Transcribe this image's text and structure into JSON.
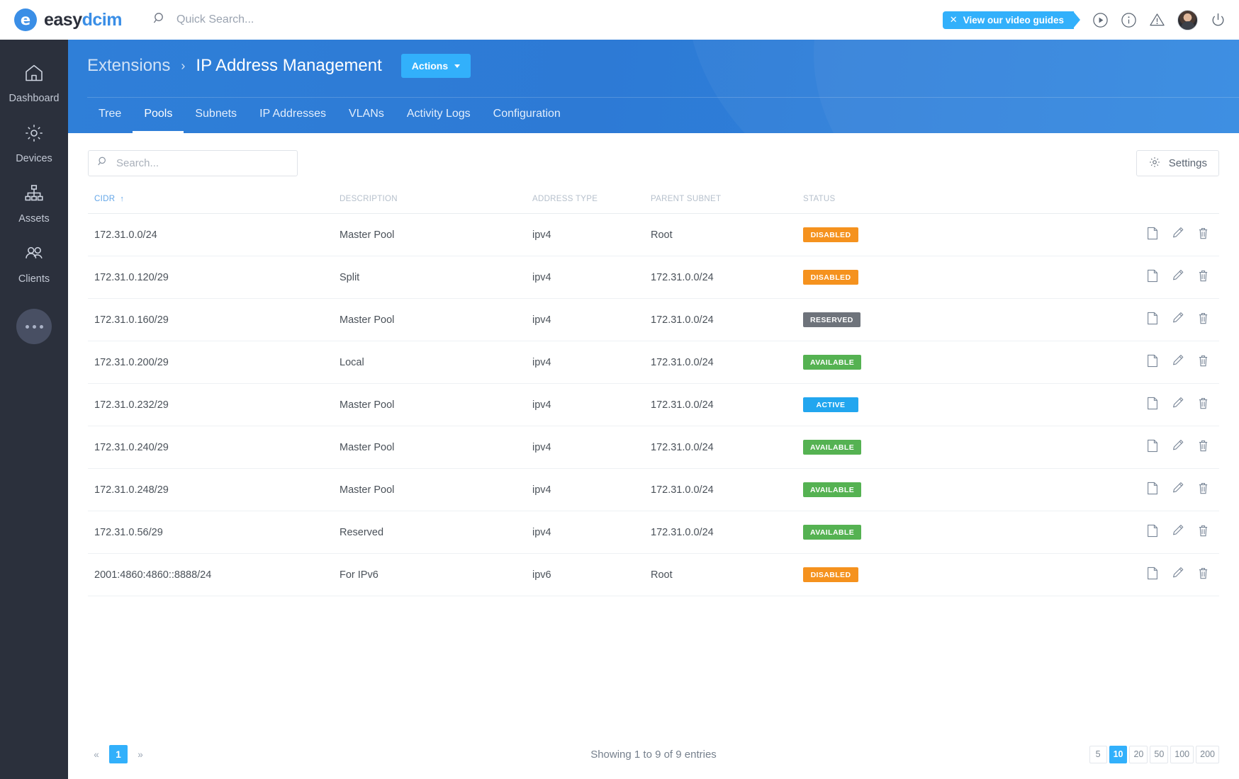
{
  "brand": {
    "logo_easy": "easy",
    "logo_dcim": "dcim",
    "logo_glyph": "e"
  },
  "topbar": {
    "quick_search_placeholder": "Quick Search...",
    "video_badge_label": "View our video guides",
    "video_badge_close": "✕",
    "icons": [
      "play-circle-icon",
      "info-circle-icon",
      "warning-triangle-icon",
      "avatar",
      "power-icon"
    ]
  },
  "sidebar": {
    "items": [
      {
        "label": "Dashboard",
        "icon": "home-icon"
      },
      {
        "label": "Devices",
        "icon": "gear-icon"
      },
      {
        "label": "Assets",
        "icon": "sitemap-icon"
      },
      {
        "label": "Clients",
        "icon": "people-icon"
      }
    ],
    "more_label": "more-options"
  },
  "header": {
    "breadcrumb_parent": "Extensions",
    "breadcrumb_sep": "›",
    "breadcrumb_current": "IP Address Management",
    "actions_label": "Actions",
    "tabs": [
      {
        "label": "Tree",
        "active": false
      },
      {
        "label": "Pools",
        "active": true
      },
      {
        "label": "Subnets",
        "active": false
      },
      {
        "label": "IP Addresses",
        "active": false
      },
      {
        "label": "VLANs",
        "active": false
      },
      {
        "label": "Activity Logs",
        "active": false
      },
      {
        "label": "Configuration",
        "active": false
      }
    ]
  },
  "toolbar": {
    "search_placeholder": "Search...",
    "search_value": "",
    "settings_label": "Settings"
  },
  "table": {
    "columns": [
      {
        "key": "cidr",
        "label": "CIDR",
        "sorted": true,
        "sort_dir": "↑"
      },
      {
        "key": "description",
        "label": "DESCRIPTION",
        "sorted": false
      },
      {
        "key": "address_type",
        "label": "ADDRESS TYPE",
        "sorted": false
      },
      {
        "key": "parent_subnet",
        "label": "PARENT SUBNET",
        "sorted": false
      },
      {
        "key": "status",
        "label": "STATUS",
        "sorted": false
      }
    ],
    "row_action_icons": [
      "split-page-icon",
      "edit-pencil-icon",
      "delete-trash-icon"
    ],
    "rows": [
      {
        "cidr": "172.31.0.0/24",
        "description": "Master Pool",
        "address_type": "ipv4",
        "parent_subnet": "Root",
        "status": "DISABLED",
        "status_kind": "disabled"
      },
      {
        "cidr": "172.31.0.120/29",
        "description": "Split",
        "address_type": "ipv4",
        "parent_subnet": "172.31.0.0/24",
        "status": "DISABLED",
        "status_kind": "disabled"
      },
      {
        "cidr": "172.31.0.160/29",
        "description": "Master Pool",
        "address_type": "ipv4",
        "parent_subnet": "172.31.0.0/24",
        "status": "RESERVED",
        "status_kind": "reserved"
      },
      {
        "cidr": "172.31.0.200/29",
        "description": "Local",
        "address_type": "ipv4",
        "parent_subnet": "172.31.0.0/24",
        "status": "AVAILABLE",
        "status_kind": "available"
      },
      {
        "cidr": "172.31.0.232/29",
        "description": "Master Pool",
        "address_type": "ipv4",
        "parent_subnet": "172.31.0.0/24",
        "status": "ACTIVE",
        "status_kind": "active"
      },
      {
        "cidr": "172.31.0.240/29",
        "description": "Master Pool",
        "address_type": "ipv4",
        "parent_subnet": "172.31.0.0/24",
        "status": "AVAILABLE",
        "status_kind": "available"
      },
      {
        "cidr": "172.31.0.248/29",
        "description": "Master Pool",
        "address_type": "ipv4",
        "parent_subnet": "172.31.0.0/24",
        "status": "AVAILABLE",
        "status_kind": "available"
      },
      {
        "cidr": "172.31.0.56/29",
        "description": "Reserved",
        "address_type": "ipv4",
        "parent_subnet": "172.31.0.0/24",
        "status": "AVAILABLE",
        "status_kind": "available"
      },
      {
        "cidr": "2001:4860:4860::8888/24",
        "description": "For IPv6",
        "address_type": "ipv6",
        "parent_subnet": "Root",
        "status": "DISABLED",
        "status_kind": "disabled"
      }
    ]
  },
  "footer": {
    "prev_label": "«",
    "next_label": "»",
    "pages": [
      "1"
    ],
    "current_page": "1",
    "showing_text": "Showing 1 to 9 of 9 entries",
    "page_lengths": [
      "5",
      "10",
      "20",
      "50",
      "100",
      "200"
    ],
    "page_length_active": "10"
  },
  "colors": {
    "accent_blue": "#32b0fb",
    "header_blue": "#2f7fd8",
    "sidebar_dark": "#2b303c",
    "status_disabled": "#f5921e",
    "status_reserved": "#6e737b",
    "status_available": "#55b252",
    "status_active": "#22a6ef"
  }
}
